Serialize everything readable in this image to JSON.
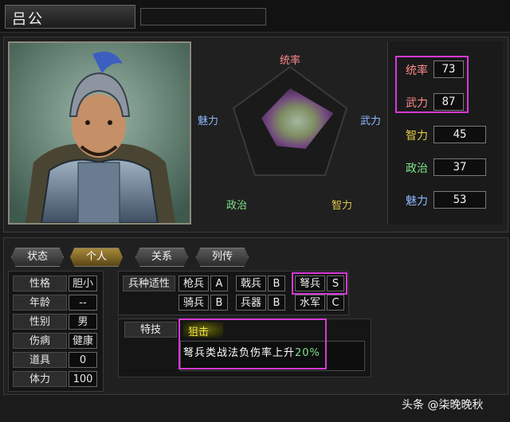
{
  "header": {
    "name": "吕公",
    "subtitle": ""
  },
  "radar": {
    "labels": {
      "top": "统率",
      "right": "武力",
      "bottom_right": "智力",
      "bottom_left": "政治",
      "left": "魅力"
    },
    "values": [
      73,
      87,
      45,
      37,
      53
    ]
  },
  "stats": [
    {
      "label": "统率",
      "value": "73",
      "color": "#ff8a8a"
    },
    {
      "label": "武力",
      "value": "87",
      "color": "#ff8a8a"
    },
    {
      "label": "智力",
      "value": "45",
      "color": "#e3c84a"
    },
    {
      "label": "政治",
      "value": "37",
      "color": "#7be38a"
    },
    {
      "label": "魅力",
      "value": "53",
      "color": "#8fb8ff"
    }
  ],
  "tabs": [
    "状态",
    "个人",
    "关系",
    "列传"
  ],
  "personal": [
    {
      "label": "性格",
      "value": "胆小"
    },
    {
      "label": "年龄",
      "value": "--"
    },
    {
      "label": "性别",
      "value": "男"
    },
    {
      "label": "伤病",
      "value": "健康"
    },
    {
      "label": "道具",
      "value": "0"
    },
    {
      "label": "体力",
      "value": "100"
    }
  ],
  "aptitude": {
    "title": "兵种适性",
    "row1": [
      {
        "unit": "枪兵",
        "grade": "A"
      },
      {
        "unit": "戟兵",
        "grade": "B"
      },
      {
        "unit": "弩兵",
        "grade": "S"
      }
    ],
    "row2": [
      {
        "unit": "骑兵",
        "grade": "B"
      },
      {
        "unit": "兵器",
        "grade": "B"
      },
      {
        "unit": "水军",
        "grade": "C"
      }
    ]
  },
  "skill": {
    "title": "特技",
    "name": "狙击",
    "desc_prefix": "弩兵类战法负伤率上升",
    "desc_value": "20%"
  },
  "watermark": "头条 @柒晚晚秋",
  "colors": {
    "highlight": "#d53ad5",
    "skill_name": "#f0e04a",
    "percent": "#7be38a"
  }
}
